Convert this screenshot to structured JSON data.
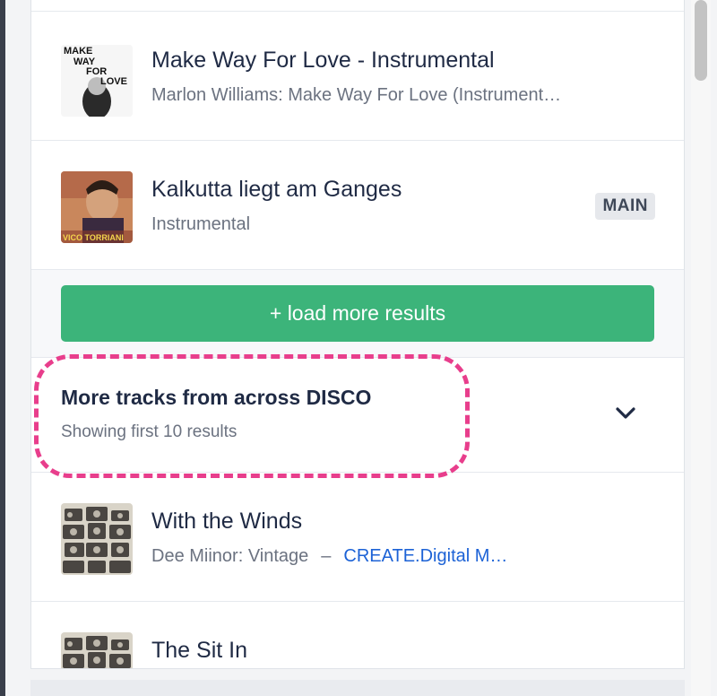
{
  "results": [
    {
      "title": "Make Way For Love - Instrumental",
      "subtitle": "Marlon Williams: Make Way For Love (Instrument…",
      "art_text": [
        "MAKE",
        "WAY",
        "FOR",
        "LOVE"
      ]
    },
    {
      "title": "Kalkutta liegt am Ganges",
      "subtitle": "Instrumental",
      "badge": "MAIN",
      "art_text": [
        "VICO TORRIANI"
      ]
    }
  ],
  "load_more": {
    "label": "+ load more results"
  },
  "more_section": {
    "title": "More tracks from across DISCO",
    "subtitle": "Showing first 10 results"
  },
  "more_results": [
    {
      "title": "With the Winds",
      "subtitle": "Dee Miinor: Vintage",
      "separator": "–",
      "link": "CREATE.Digital M…"
    },
    {
      "title": "The Sit In"
    }
  ],
  "colors": {
    "accent_green": "#3cb47a",
    "highlight_pink": "#e83e8c",
    "link_blue": "#1c62d6"
  },
  "icons": {
    "chevron": "chevron-down-icon"
  }
}
